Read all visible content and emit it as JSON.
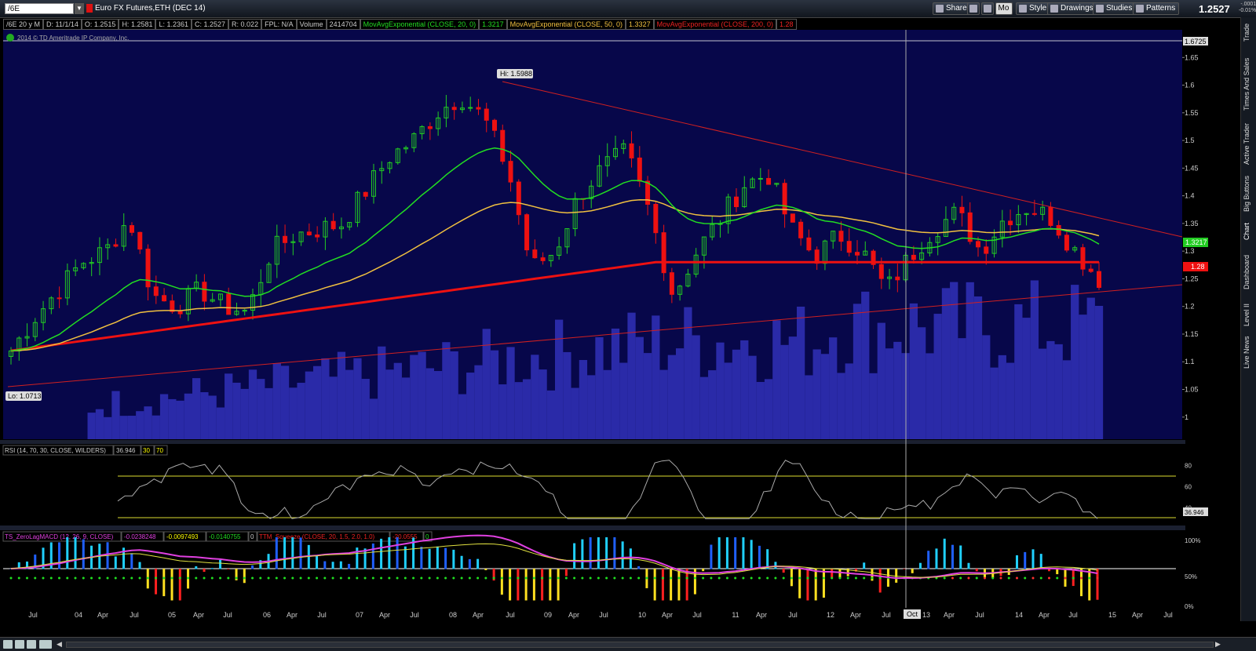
{
  "toolbar": {
    "symbol": "/6E",
    "description": "Euro FX Futures,ETH (DEC 14)",
    "buttons": {
      "share": "Share",
      "mo": "Mo",
      "style": "Style",
      "drawings": "Drawings",
      "studies": "Studies",
      "patterns": "Patterns"
    },
    "last_price": "1.2527",
    "change_top": "-.0001",
    "change_bottom": "-0.01%"
  },
  "study_bar": {
    "period": "/6E 20 y M",
    "date": "D: 11/1/14",
    "open": "O: 1.2515",
    "high": "H: 1.2581",
    "low": "L: 1.2361",
    "close": "C: 1.2527",
    "range": "R: 0.022",
    "fpl": "FPL: N/A",
    "volume_label": "Volume",
    "volume_value": "2414704",
    "ema20_label": "MovAvgExponential (CLOSE, 20, 0)",
    "ema20_value": "1.3217",
    "ema50_label": "MovAvgExponential (CLOSE, 50, 0)",
    "ema50_value": "1.3327",
    "ema200_label": "MovAvgExponential (CLOSE, 200, 0)",
    "ema200_value": "1.28"
  },
  "copyright": "2014 © TD Ameritrade IP Company, Inc.",
  "price_labels": {
    "high": "Hi: 1.5988",
    "low": "Lo: 1.0713",
    "top_axis": "1.6725",
    "ema20_tag": "1.3217",
    "ema200_tag": "1.28"
  },
  "price_axis": [
    "1.65",
    "1.6",
    "1.55",
    "1.5",
    "1.45",
    "1.4",
    "1.35",
    "1.3",
    "1.25",
    "1.2",
    "1.15",
    "1.1",
    "1.05",
    "1"
  ],
  "rsi": {
    "label": "RSI (14, 70, 30, CLOSE, WILDERS)",
    "value": "36.946",
    "level_low": "30",
    "level_high": "70",
    "axis": [
      "80",
      "60",
      "40"
    ],
    "tag": "36.946"
  },
  "macd": {
    "label": "TS_ZeroLagMACD (12, 26, 9, CLOSE)",
    "v1": "-0.0238248",
    "v2": "-0.0097493",
    "v3": "-0.0140755",
    "v4": "0",
    "squeeze_label": "TTM_Squeeze (CLOSE, 20, 1.5, 2.0, 1.0)",
    "squeeze_value": "-20.0555",
    "squeeze_v2": "0",
    "axis": [
      "100%",
      "50%",
      "0%"
    ]
  },
  "time_axis": [
    "Jul",
    "04",
    "Apr",
    "Jul",
    "05",
    "Apr",
    "Jul",
    "06",
    "Apr",
    "Jul",
    "07",
    "Apr",
    "Jul",
    "08",
    "Apr",
    "Jul",
    "09",
    "Apr",
    "Jul",
    "10",
    "Apr",
    "Jul",
    "11",
    "Apr",
    "Jul",
    "12",
    "Apr",
    "Jul",
    "Oct",
    "13",
    "Apr",
    "Jul",
    "14",
    "Apr",
    "Jul",
    "15",
    "Apr",
    "Jul"
  ],
  "cursor_label": "Oct",
  "sidebar_tabs": [
    "Trade",
    "Times And Sales",
    "Active Trader",
    "Big Buttons",
    "Chart",
    "Dashboard",
    "Level II",
    "Live News"
  ],
  "colors": {
    "background": "#07074a",
    "up_candle": "#22cc22",
    "down_candle": "#ee1111",
    "ema20": "#22dd22",
    "ema50": "#f0c040",
    "ema200": "#ee1111",
    "volume": "#2a2aa8"
  },
  "chart_data": {
    "type": "candlestick",
    "title": "/6E 20 y M",
    "ylim": [
      0.96,
      1.7
    ],
    "monthly_closes_approx": [
      1.12,
      1.18,
      1.23,
      1.28,
      1.3,
      1.36,
      1.22,
      1.2,
      1.23,
      1.2,
      1.19,
      1.3,
      1.33,
      1.34,
      1.35,
      1.41,
      1.47,
      1.5,
      1.55,
      1.58,
      1.54,
      1.45,
      1.27,
      1.3,
      1.4,
      1.45,
      1.48,
      1.37,
      1.22,
      1.3,
      1.36,
      1.42,
      1.44,
      1.34,
      1.29,
      1.33,
      1.3,
      1.23,
      1.29,
      1.34,
      1.37,
      1.3,
      1.36,
      1.38,
      1.36,
      1.3,
      1.25
    ],
    "high_label": 1.5988,
    "low_label": 1.0713
  }
}
